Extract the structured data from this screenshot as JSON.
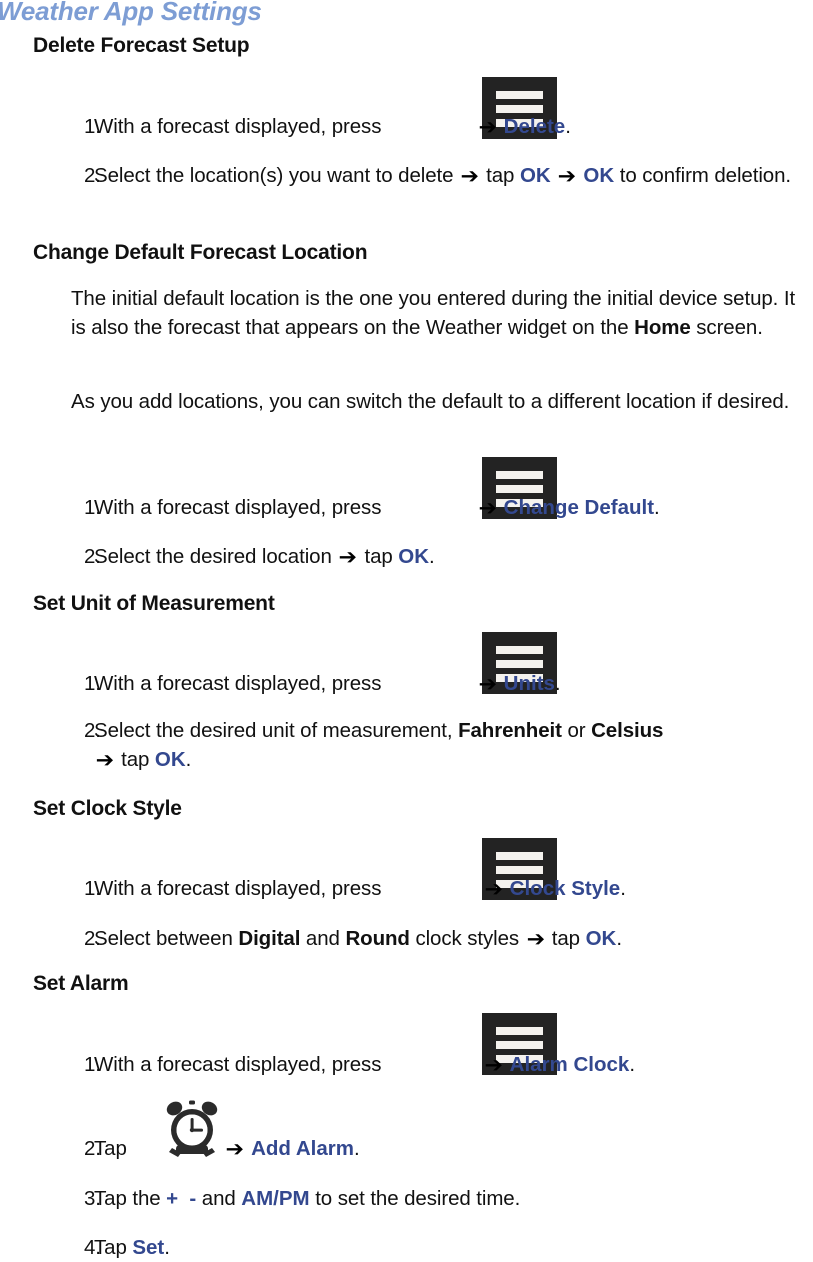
{
  "document": {
    "title": "Weather App Settings"
  },
  "icons": {
    "menu": "menu-icon",
    "alarm_clock": "alarm-clock-icon",
    "arrow": "right-arrow-icon"
  },
  "colors": {
    "title": "#7d9dd4",
    "link_blue": "#33488f",
    "icon_dark": "#232323",
    "body_text": "#111111"
  },
  "sections": [
    {
      "heading": "Delete Forecast Setup",
      "items": [
        {
          "num": "1.",
          "pre": "With a forecast displayed, press",
          "icon": "menu",
          "arrow": "➔",
          "link": "Delete",
          "post": "."
        },
        {
          "num": "2.",
          "pre": "Select the location(s) you want to delete",
          "arrow": "➔",
          "mid": "tap",
          "link": "OK",
          "arrow2": "➔",
          "link2": "OK",
          "post": "to confirm deletion."
        }
      ]
    },
    {
      "heading": "Change Default Forecast Location",
      "paragraphs": [
        {
          "a": "The initial default location is the one you entered during the initial device setup. It is also the forecast that appears on the Weather widget on the ",
          "bold": "Home",
          "b": " screen."
        },
        {
          "a": "As you add locations, you can switch the default to a different location if desired."
        }
      ],
      "items": [
        {
          "num": "1.",
          "pre": "With a forecast displayed, press",
          "icon": "menu",
          "arrow": "➔",
          "link": "Change Default",
          "post": "."
        },
        {
          "num": "2.",
          "pre": "Select the desired location",
          "arrow": "➔",
          "mid": "tap",
          "link": "OK",
          "post": "."
        }
      ]
    },
    {
      "heading": "Set Unit of Measurement",
      "items": [
        {
          "num": "1.",
          "pre": "With a forecast displayed, press",
          "icon": "menu",
          "arrow": "➔",
          "link": "Units",
          "post": "."
        },
        {
          "num": "2.",
          "pre": "Select the desired unit of measurement, ",
          "bold1": "Fahrenheit",
          "mid1": " or ",
          "bold2": "Celsius",
          "arrow": "➔",
          "mid": "tap",
          "link": "OK",
          "post": "."
        }
      ]
    },
    {
      "heading": "Set Clock Style",
      "items": [
        {
          "num": "1.",
          "pre": "With a forecast displayed, press",
          "icon": "menu",
          "arrow": "➔",
          "link": "Clock Style",
          "post": "."
        },
        {
          "num": "2.",
          "pre": "Select between ",
          "bold1": "Digital",
          "mid1": " and ",
          "bold2": "Round",
          "mid2": " clock styles",
          "arrow": "➔",
          "mid": "tap",
          "link": "OK",
          "post": "."
        }
      ]
    },
    {
      "heading": "Set Alarm",
      "items": [
        {
          "num": "1.",
          "pre": "With a forecast displayed, press",
          "icon": "menu",
          "arrow": "➔",
          "link": "Alarm Clock",
          "post": "."
        },
        {
          "num": "2.",
          "pre": "Tap",
          "icon": "alarm",
          "arrow": "➔",
          "link": "Add Alarm",
          "post": "."
        },
        {
          "num": "3.",
          "pre": "Tap the ",
          "plus": "+",
          "minus": "-",
          "mid1": " and ",
          "ampm": "AM/PM",
          "post": " to set the desired time."
        },
        {
          "num": "4.",
          "pre": "Tap ",
          "link": "Set",
          "post": "."
        }
      ]
    }
  ]
}
